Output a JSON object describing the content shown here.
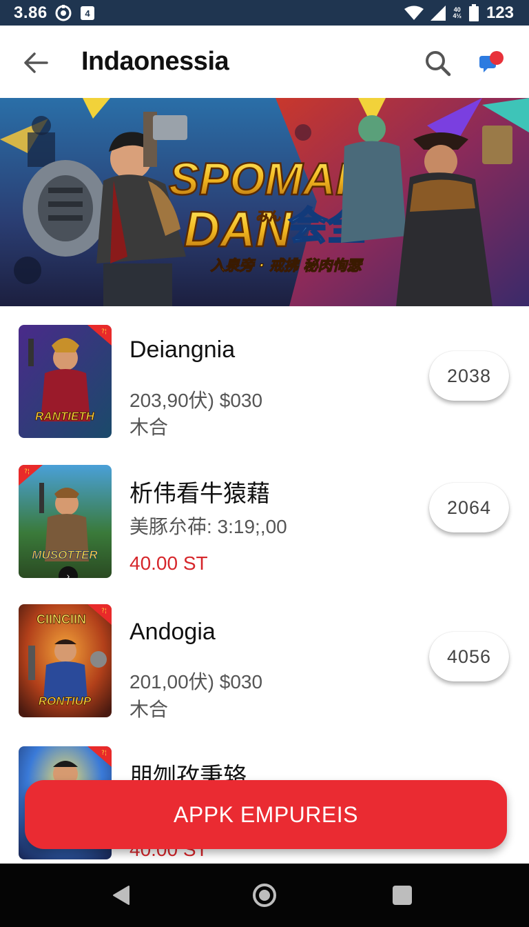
{
  "status_bar": {
    "time": "3.86",
    "network_line1": "40",
    "network_line2": "4½",
    "battery_text": "123",
    "icons": [
      "sync-icon",
      "notification-icon",
      "wifi-icon",
      "signal-icon",
      "battery-icon"
    ]
  },
  "header": {
    "title": "Indaonessia",
    "back_icon": "arrow-left-icon",
    "search_icon": "search-icon",
    "chat_icon": "chat-icon",
    "chat_badge_color": "#e8313a",
    "chat_bubble_color": "#2d7be0"
  },
  "banner": {
    "title_line1": "SPOMAR",
    "title_line2": "DAN",
    "title_cjk": "会全",
    "title_small": "みん",
    "subtitle": "入泉旁 · 戒拂  秘肉恂瑟"
  },
  "apps": [
    {
      "name": "Deiangnia",
      "meta": "203,90伏) $030",
      "sub": "木合",
      "price": "",
      "pill": "2038",
      "thumb_text": "RANTIETH",
      "thumb_corner": "?¦"
    },
    {
      "name": "析伟看牛猿藉",
      "meta": "美豚厼茽: 3:19;,00",
      "sub": "",
      "price": "40.00 ST",
      "pill": "2064",
      "thumb_text": "MUSOTTER",
      "thumb_corner": "?¦"
    },
    {
      "name": "Andogia",
      "meta": "201,00伏) $030",
      "sub": "木合",
      "price": "",
      "pill": "4056",
      "thumb_text": "RONTIUP",
      "thumb_top_text": "CIINCIIN",
      "thumb_corner": "?¦"
    },
    {
      "name": "朋刎孜秉辂",
      "meta": "",
      "sub": "",
      "price": "40.00 ST",
      "pill": "",
      "thumb_text": "",
      "thumb_corner": "?¦"
    }
  ],
  "cta": {
    "label": "APPK EMPUREIS",
    "color": "#ea2b32"
  },
  "nav": {
    "back_icon": "nav-back-icon",
    "home_icon": "nav-home-icon",
    "recents_icon": "nav-recents-icon"
  }
}
